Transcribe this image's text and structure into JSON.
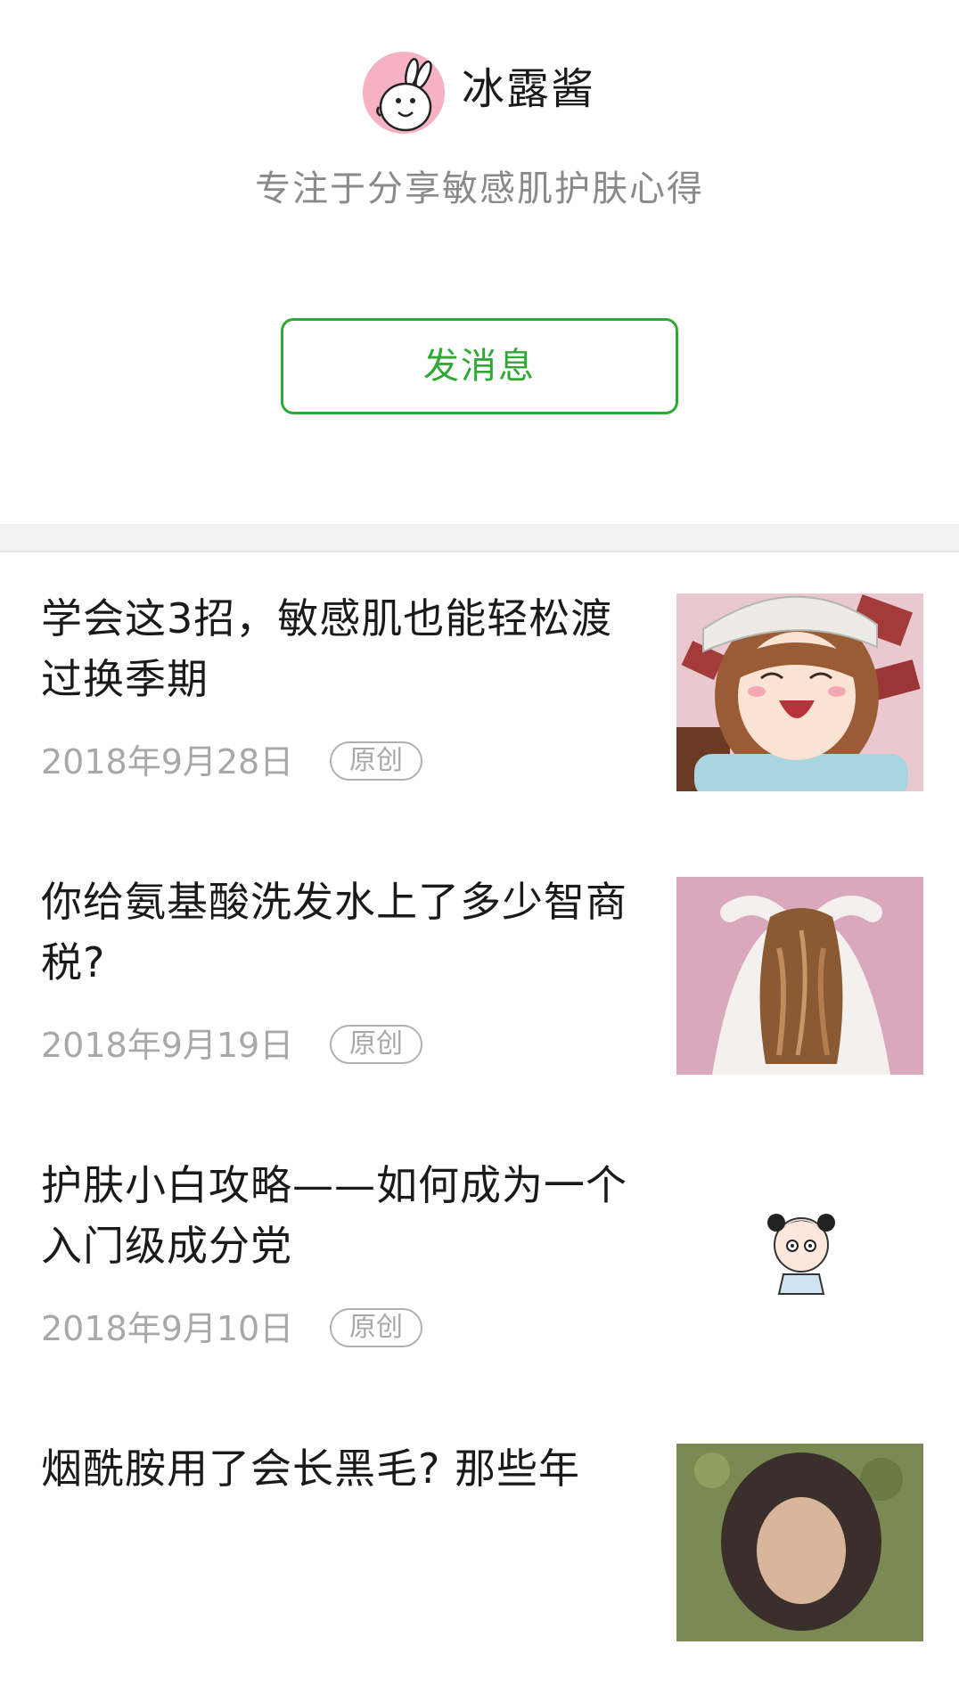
{
  "profile": {
    "name": "冰露酱",
    "bio": "专注于分享敏感肌护肤心得",
    "message_button": "发消息"
  },
  "articles": [
    {
      "title": "学会这3招，敏感肌也能轻松渡过换季期",
      "date": "2018年9月28日",
      "badge": "原创",
      "thumb_icon": "anime-girl-thumbnail"
    },
    {
      "title": "你给氨基酸洗发水上了多少智商税?",
      "date": "2018年9月19日",
      "badge": "原创",
      "thumb_icon": "hair-photo-thumbnail"
    },
    {
      "title": "护肤小白攻略——如何成为一个入门级成分党",
      "date": "2018年9月10日",
      "badge": "原创",
      "thumb_icon": "cartoon-character-thumbnail"
    },
    {
      "title": "烟酰胺用了会长黑毛? 那些年",
      "date": "",
      "badge": "",
      "thumb_icon": "photo-thumbnail"
    }
  ],
  "colors": {
    "accent": "#2fa836",
    "muted": "#a8a8a8",
    "divider": "#e6e6e6"
  }
}
